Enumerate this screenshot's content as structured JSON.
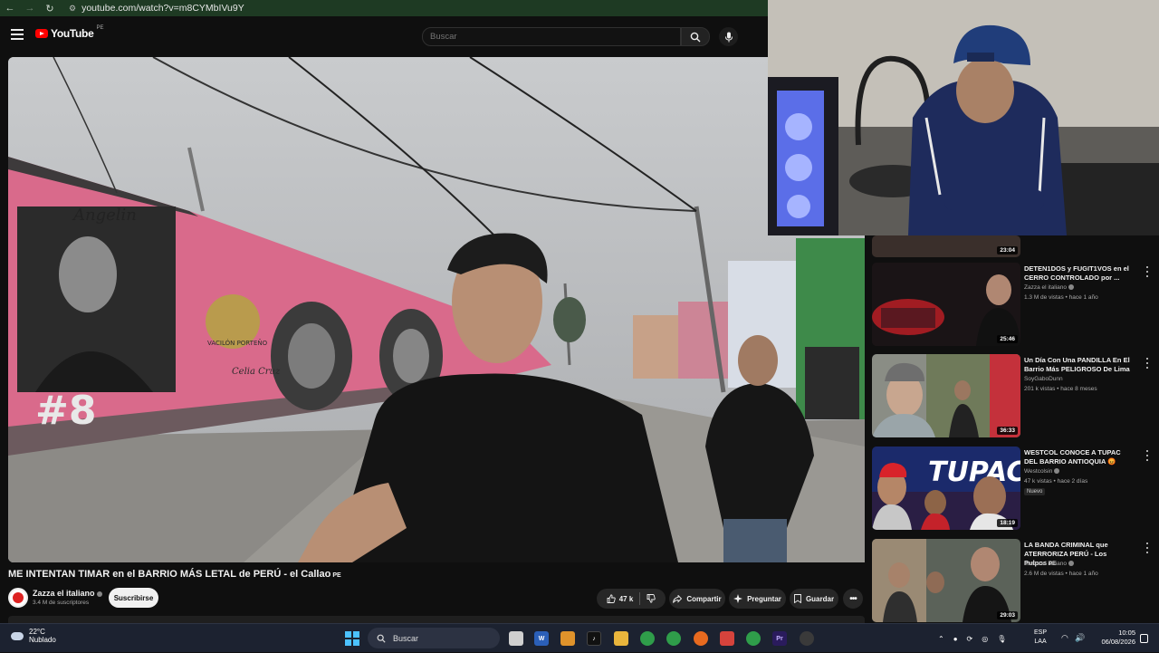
{
  "browser": {
    "url": "youtube.com/watch?v=m8CYMbIVu9Y",
    "back_icon": "arrow-left-icon",
    "forward_icon": "arrow-right-icon",
    "reload_icon": "reload-icon"
  },
  "header": {
    "logo_text": "YouTube",
    "logo_country": "PE",
    "search_placeholder": "Buscar"
  },
  "video_overlay_text": {
    "mural_name": "Angelin",
    "mural_number": "#8",
    "mural_badge": "VACILÓN PORTEÑO",
    "mural_script": "Celia Cruz"
  },
  "video": {
    "title": "ME INTENTAN TIMAR en el BARRIO MÁS LETAL de PERÚ - el Callao",
    "title_flag": "PE",
    "channel": "Zazza el italiano",
    "subscribers": "3.4 M de suscriptores",
    "subscribe_label": "Suscribirse",
    "likes": "47 k",
    "share_label": "Compartir",
    "ask_label": "Preguntar",
    "save_label": "Guardar"
  },
  "recommendations": [
    {
      "title": "",
      "channel": "",
      "meta": "",
      "duration": "23:04"
    },
    {
      "title": "DETEN1DOS y FUGIT1VOS en el CERRO CONTROLADO por ...",
      "channel": "Zazza el italiano",
      "meta": "1.3 M de vistas • hace 1 año",
      "duration": "25:46"
    },
    {
      "title": "Un Día Con Una PANDILLA En El Barrio Más PELIGROSO De Lima",
      "channel": "SoyGaboDunn",
      "meta": "201 k vistas • hace 8 meses",
      "duration": "36:33"
    },
    {
      "title": "WESTCOL CONOCE A TUPAC DEL BARRIO ANTIOQUIA 😡",
      "channel": "Westcolsin",
      "meta": "47 k vistas • hace 2 días",
      "badge": "Nuevo",
      "duration": "18:19",
      "thumb_text": "TUPAC"
    },
    {
      "title": "LA BANDA CRIMINAL que ATERRORIZA PERÚ - Los Pulpos",
      "title_flag": "PE",
      "channel": "Zazza el italiano",
      "meta": "2.6 M de vistas • hace 1 año",
      "duration": "29:03"
    }
  ],
  "taskbar": {
    "weather_temp": "22°C",
    "weather_condition": "Nublado",
    "search_label": "Buscar",
    "language_line1": "ESP",
    "language_line2": "LAA",
    "time": "10:05",
    "date": "06/08/2026",
    "pinned_icons": [
      "file-explorer-icon",
      "word-icon",
      "store-icon",
      "tiktok-icon",
      "folder-icon",
      "chrome-icon",
      "chrome-icon",
      "firefox-icon",
      "app-icon",
      "chrome-active-icon",
      "premiere-icon",
      "obs-icon"
    ]
  },
  "colors": {
    "youtube_red": "#ff0000",
    "mural_pink": "#e06b8d",
    "browser_bar": "#1e3a23",
    "taskbar": "#1c2230"
  }
}
